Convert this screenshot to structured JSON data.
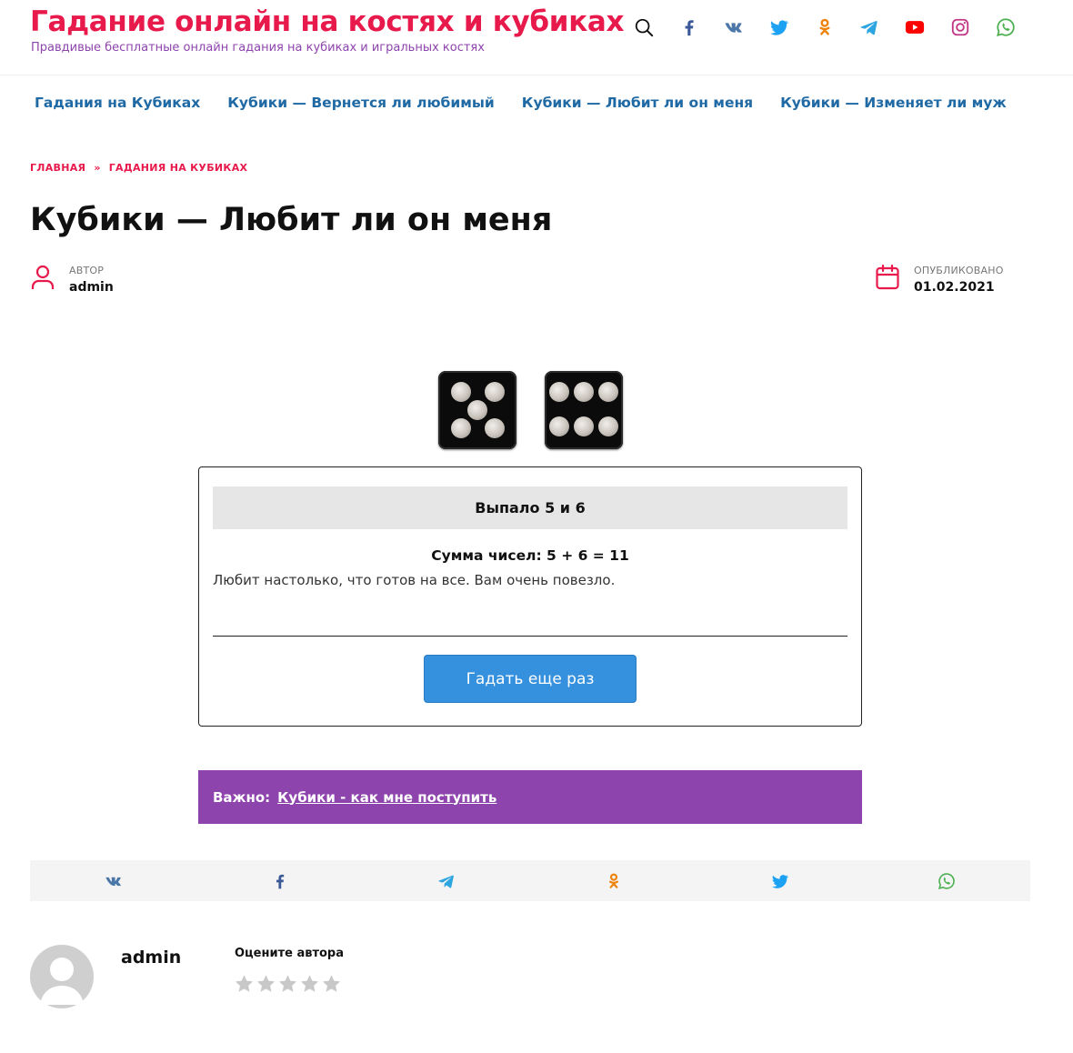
{
  "header": {
    "site_title": "Гадание онлайн на костях и кубиках",
    "site_description": "Правдивые бесплатные онлайн гадания на кубиках и игральных костях",
    "icons": [
      "search-icon",
      "facebook-icon",
      "vk-icon",
      "twitter-icon",
      "odnoklassniki-icon",
      "telegram-icon",
      "youtube-icon",
      "instagram-icon",
      "whatsapp-icon"
    ]
  },
  "nav": {
    "items": [
      {
        "label": "Гадания на Кубиках"
      },
      {
        "label": "Кубики — Вернется ли любимый"
      },
      {
        "label": "Кубики — Любит ли он меня"
      },
      {
        "label": "Кубики — Изменяет ли муж"
      }
    ]
  },
  "breadcrumb": {
    "home": "ГЛАВНАЯ",
    "separator": "»",
    "category": "ГАДАНИЯ НА КУБИКАХ"
  },
  "article": {
    "title": "Кубики — Любит ли он меня",
    "author_label": "АВТОР",
    "author": "admin",
    "published_label": "ОПУБЛИКОВАНО",
    "published": "01.02.2021"
  },
  "dice": {
    "values": [
      5,
      6
    ]
  },
  "result": {
    "header": "Выпало 5 и 6",
    "sum": "Сумма чисел: 5 + 6 = 11",
    "text": "Любит настолько, что готов на все. Вам очень повезло.",
    "button_label": "Гадать еще раз"
  },
  "important": {
    "label": "Важно:",
    "link_text": "Кубики - как мне поступить"
  },
  "share": {
    "icons": [
      "vk-icon",
      "facebook-icon",
      "telegram-icon",
      "odnoklassniki-icon",
      "twitter-icon",
      "whatsapp-icon"
    ]
  },
  "author_box": {
    "name": "admin",
    "rate_label": "Оцените автора",
    "rating": 0,
    "max_rating": 5
  },
  "colors": {
    "brand": "#e8194b",
    "tagline": "#8e44ad",
    "nav": "#1f6aa5",
    "button": "#3590de",
    "important_bg": "#8e44ad",
    "facebook": "#3b5998",
    "vk": "#4a76a8",
    "twitter": "#1da1f2",
    "odnoklassniki": "#ee8208",
    "telegram": "#2ca5e0",
    "youtube": "#ff0000",
    "instagram": "#c13584",
    "whatsapp": "#4caf50"
  }
}
